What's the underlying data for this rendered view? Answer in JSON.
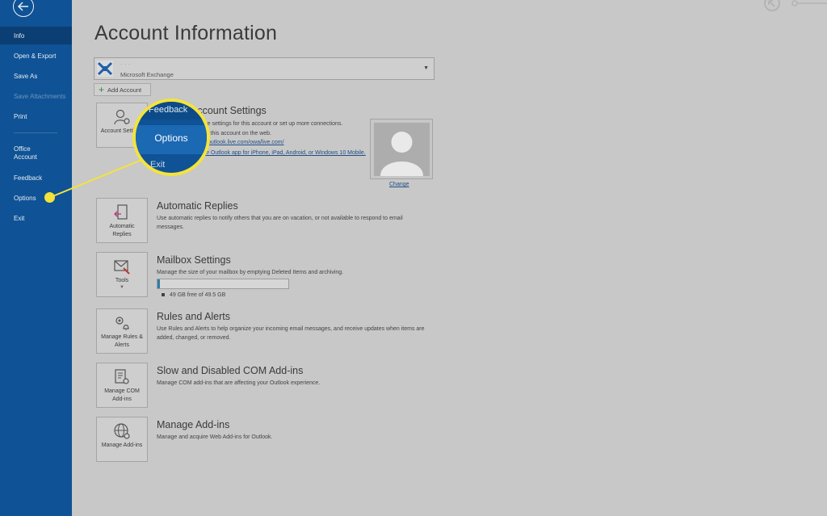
{
  "sidebar": {
    "items": [
      {
        "label": "Info",
        "active": true
      },
      {
        "label": "Open & Export"
      },
      {
        "label": "Save As"
      },
      {
        "label": "Save Attachments",
        "disabled": true
      },
      {
        "label": "Print"
      },
      {
        "label": "Office Account"
      },
      {
        "label": "Feedback"
      },
      {
        "label": "Options"
      },
      {
        "label": "Exit"
      }
    ]
  },
  "main": {
    "title": "Account Information",
    "account": {
      "type": "Microsoft Exchange",
      "name_redacted": "· · ·"
    },
    "add_account": "Add Account",
    "account_settings": {
      "tile_label": "Account Settings",
      "title": "Account Settings",
      "desc_line1": "Change settings for this account or set up more connections.",
      "desc_line2": "Access this account on the web.",
      "link1": "https://outlook.live.com/owa/live.com/",
      "link2": "Get the Outlook app for iPhone, iPad, Android, or Windows 10 Mobile.",
      "change_link": "Change"
    },
    "sections": [
      {
        "tile": "Automatic Replies",
        "title": "Automatic Replies",
        "desc": "Use automatic replies to notify others that you are on vacation, or not available to respond to email messages."
      },
      {
        "tile": "Tools",
        "title": "Mailbox Settings",
        "desc": "Manage the size of your mailbox by emptying Deleted Items and archiving."
      },
      {
        "tile": "Manage Rules & Alerts",
        "title": "Rules and Alerts",
        "desc": "Use Rules and Alerts to help organize your incoming email messages, and receive updates when items are added, changed, or removed."
      },
      {
        "tile": "Manage COM Add-ins",
        "title": "Slow and Disabled COM Add-ins",
        "desc": "Manage COM add-ins that are affecting your Outlook experience."
      },
      {
        "tile": "Manage Add-ins",
        "title": "Manage Add-ins",
        "desc": "Manage and acquire Web Add-ins for Outlook."
      }
    ],
    "storage": {
      "text": "49 GB free of 49.5 GB",
      "used_fraction": 0.01
    }
  },
  "callout": {
    "top_text": "Feedback",
    "highlight": "Options",
    "bottom_text": "Exit",
    "color": "#f4e33b"
  },
  "colors": {
    "sidebar": "#0f5295",
    "accent": "#f4e33b",
    "background": "#c8c8c8"
  }
}
